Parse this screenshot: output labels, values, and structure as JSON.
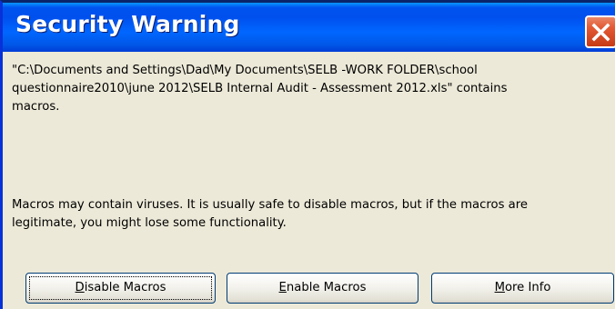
{
  "dialog": {
    "title": "Security Warning",
    "close_icon": "close-icon",
    "message_lines": [
      "\"C:\\Documents and Settings\\Dad\\My Documents\\SELB -WORK FOLDER\\school",
      "questionnaire2010\\june 2012\\SELB Internal Audit - Assessment 2012.xls\" contains",
      "macros."
    ],
    "warning_lines": [
      "Macros may contain viruses. It is usually safe to disable macros, but if the macros are",
      "legitimate, you might lose some functionality."
    ]
  },
  "buttons": {
    "disable": {
      "mnemonic": "D",
      "rest": "isable Macros"
    },
    "enable": {
      "mnemonic": "E",
      "rest": "nable Macros"
    },
    "more_info": {
      "mnemonic": "M",
      "rest": "ore Info"
    }
  },
  "colors": {
    "title_bar": "#0054e3",
    "window_bg": "#ece9d8",
    "close_button": "#e35a34",
    "button_border": "#003c74"
  }
}
